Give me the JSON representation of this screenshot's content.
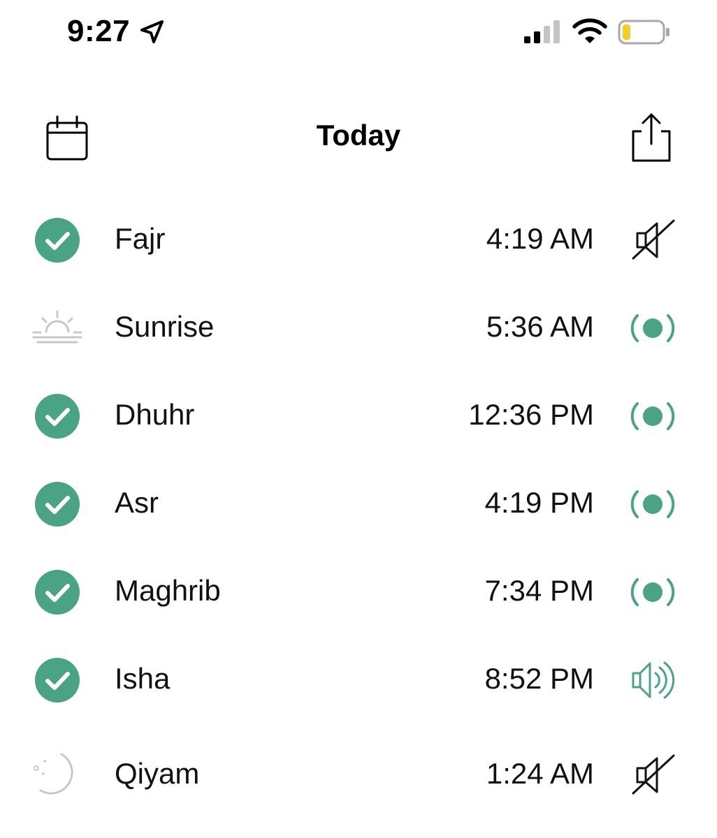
{
  "status_bar": {
    "time": "9:27",
    "location_icon": "location-arrow-icon",
    "signal_icon": "cellular-signal-icon",
    "wifi_icon": "wifi-icon",
    "battery_icon": "battery-low-icon",
    "battery_color": "#f2cf2d"
  },
  "header": {
    "title": "Today",
    "left_icon": "calendar-icon",
    "right_icon": "share-icon"
  },
  "colors": {
    "accent": "#4aa383",
    "muted": "#c8c8c8",
    "text": "#111111"
  },
  "prayers": [
    {
      "name": "Fajr",
      "time": "4:19 AM",
      "status_icon": "check-circle-icon",
      "notification_icon": "speaker-muted-icon"
    },
    {
      "name": "Sunrise",
      "time": "5:36 AM",
      "status_icon": "sunrise-icon",
      "notification_icon": "notification-dot-icon"
    },
    {
      "name": "Dhuhr",
      "time": "12:36 PM",
      "status_icon": "check-circle-icon",
      "notification_icon": "notification-dot-icon"
    },
    {
      "name": "Asr",
      "time": "4:19 PM",
      "status_icon": "check-circle-icon",
      "notification_icon": "notification-dot-icon"
    },
    {
      "name": "Maghrib",
      "time": "7:34 PM",
      "status_icon": "check-circle-icon",
      "notification_icon": "notification-dot-icon"
    },
    {
      "name": "Isha",
      "time": "8:52 PM",
      "status_icon": "check-circle-icon",
      "notification_icon": "speaker-sound-icon"
    },
    {
      "name": "Qiyam",
      "time": "1:24 AM",
      "status_icon": "crescent-moon-icon",
      "notification_icon": "speaker-muted-icon"
    }
  ]
}
